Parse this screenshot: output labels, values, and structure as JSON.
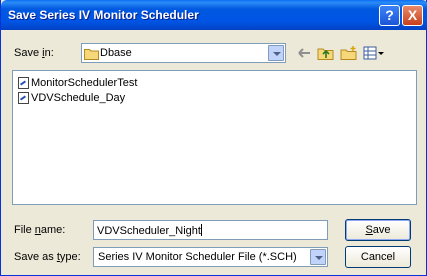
{
  "window": {
    "title": "Save Series IV Monitor Scheduler"
  },
  "titlebar": {
    "help_glyph": "?",
    "close_glyph": "X"
  },
  "savein": {
    "label_pre": "Save ",
    "label_accel": "i",
    "label_post": "n:",
    "folder": "Dbase"
  },
  "files": [
    {
      "name": "MonitorSchedulerTest"
    },
    {
      "name": "VDVSchedule_Day"
    }
  ],
  "filename": {
    "label_pre": "File ",
    "label_accel": "n",
    "label_post": "ame:",
    "value": "VDVScheduler_Night"
  },
  "savetype": {
    "label_pre": "Save as ",
    "label_accel": "t",
    "label_post": "ype:",
    "value": "Series IV Monitor Scheduler File (*.SCH)"
  },
  "buttons": {
    "save_accel": "S",
    "save_rest": "ave",
    "cancel": "Cancel"
  },
  "colors": {
    "titlebar": "#0055e5",
    "face": "#ece9d8",
    "border": "#7f9db9"
  }
}
